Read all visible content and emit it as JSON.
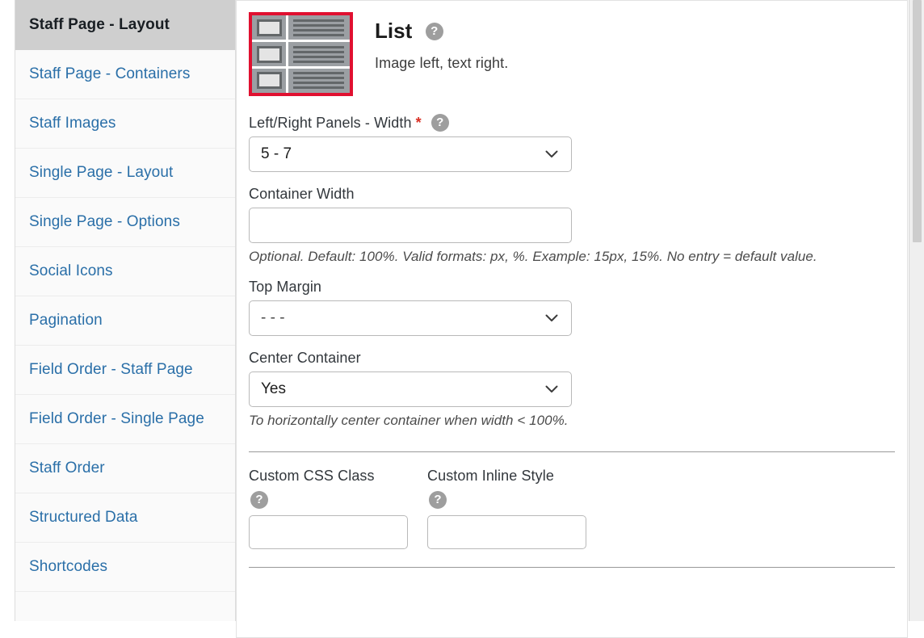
{
  "sidebar": {
    "items": [
      {
        "label": "Staff Page - Layout",
        "active": true
      },
      {
        "label": "Staff Page - Containers",
        "active": false
      },
      {
        "label": "Staff Images",
        "active": false
      },
      {
        "label": "Single Page - Layout",
        "active": false
      },
      {
        "label": "Single Page - Options",
        "active": false
      },
      {
        "label": "Social Icons",
        "active": false
      },
      {
        "label": "Pagination",
        "active": false
      },
      {
        "label": "Field Order - Staff Page",
        "active": false
      },
      {
        "label": "Field Order - Single Page",
        "active": false
      },
      {
        "label": "Staff Order",
        "active": false
      },
      {
        "label": "Structured Data",
        "active": false
      },
      {
        "label": "Shortcodes",
        "active": false
      }
    ]
  },
  "layout_header": {
    "thumbnail_name": "list-layout-thumbnail",
    "title": "List",
    "help_glyph": "?",
    "description": "Image left, text right."
  },
  "form": {
    "panels_width": {
      "label": "Left/Right Panels - Width",
      "required_marker": "*",
      "value": "5 - 7",
      "help_glyph": "?"
    },
    "container_width": {
      "label": "Container Width",
      "value": "",
      "placeholder": "",
      "helper": "Optional. Default: 100%. Valid formats: px, %. Example: 15px, 15%. No entry = default value."
    },
    "top_margin": {
      "label": "Top Margin",
      "value": "- - -"
    },
    "center_container": {
      "label": "Center Container",
      "value": "Yes",
      "helper": "To horizontally center container when width < 100%."
    },
    "custom_css_class": {
      "label": "Custom CSS Class",
      "help_glyph": "?",
      "value": "",
      "placeholder": ""
    },
    "custom_inline_style": {
      "label": "Custom Inline Style",
      "help_glyph": "?",
      "value": "",
      "placeholder": ""
    }
  },
  "colors": {
    "accent_link": "#2a6fa8",
    "active_bg": "#cfcfcf",
    "thumb_border": "#e01030",
    "required": "#d93025",
    "help_icon_bg": "#9e9e9e"
  }
}
